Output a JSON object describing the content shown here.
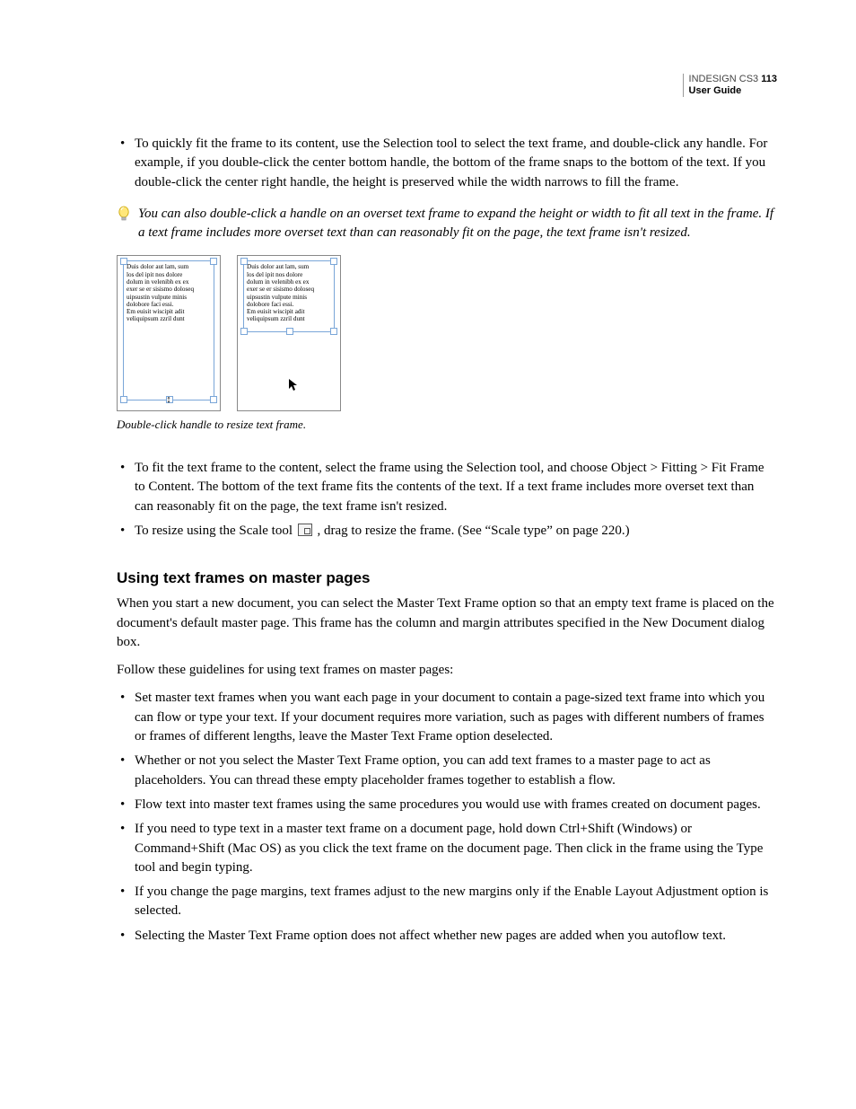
{
  "header": {
    "product": "INDESIGN CS3",
    "guide": "User Guide",
    "page": "113"
  },
  "top_bullets": [
    "To quickly fit the frame to its content, use the Selection tool to select the text frame, and double-click any handle. For example, if you double-click the center bottom handle, the bottom of the frame snaps to the bottom of the text. If you double-click the center right handle, the height is preserved while the width narrows to fill the frame."
  ],
  "tip": "You can also double-click a handle on an overset text frame to expand the height or width to fit all text in the frame. If a text frame includes more overset text than can reasonably fit on the page, the text frame isn't resized.",
  "lorem": "Duis dolor aut lam, sum\nlos del ipit nos dolore\ndolum in velenibh ex ex\nexer se er sisismo doloseq\nuipsustin vulpute minis\ndolobore faci essi.\nEm euisit wiscipit adit\nveliquipsum zzril dunt",
  "caption": "Double-click handle to resize text frame.",
  "mid_bullets": [
    "To fit the text frame to the content, select the frame using the Selection tool, and choose Object > Fitting > Fit Frame to Content. The bottom of the text frame fits the contents of the text. If a text frame includes more overset text than can reasonably fit on the page, the text frame isn't resized."
  ],
  "scale_bullet_pre": "To resize using the Scale tool ",
  "scale_bullet_post": " , drag to resize the frame. (See “Scale type” on page 220.)",
  "section": {
    "heading": "Using text frames on master pages",
    "intro1": "When you start a new document, you can select the Master Text Frame option so that an empty text frame is placed on the document's default master page. This frame has the column and margin attributes specified in the New Document dialog box.",
    "intro2": "Follow these guidelines for using text frames on master pages:",
    "bullets": [
      "Set master text frames when you want each page in your document to contain a page-sized text frame into which you can flow or type your text. If your document requires more variation, such as pages with different numbers of frames or frames of different lengths, leave the Master Text Frame option deselected.",
      "Whether or not you select the Master Text Frame option, you can add text frames to a master page to act as placeholders. You can thread these empty placeholder frames together to establish a flow.",
      "Flow text into master text frames using the same procedures you would use with frames created on document pages.",
      "If you need to type text in a master text frame on a document page, hold down Ctrl+Shift (Windows) or Command+Shift (Mac OS) as you click the text frame on the document page. Then click in the frame using the Type tool and begin typing.",
      "If you change the page margins, text frames adjust to the new margins only if the Enable Layout Adjustment option is selected.",
      "Selecting the Master Text Frame option does not affect whether new pages are added when you autoflow text."
    ]
  }
}
